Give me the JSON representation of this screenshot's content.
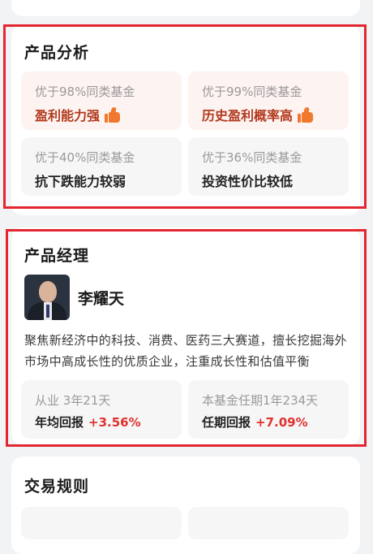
{
  "analysis": {
    "title": "产品分析",
    "tiles": [
      {
        "sub": "优于98%同类基金",
        "main": "盈利能力强",
        "thumb": true,
        "highlight": true
      },
      {
        "sub": "优于99%同类基金",
        "main": "历史盈利概率高",
        "thumb": true,
        "highlight": true
      },
      {
        "sub": "优于40%同类基金",
        "main": "抗下跌能力较弱",
        "thumb": false,
        "highlight": false
      },
      {
        "sub": "优于36%同类基金",
        "main": "投资性价比较低",
        "thumb": false,
        "highlight": false
      }
    ]
  },
  "manager": {
    "title": "产品经理",
    "name": "李耀天",
    "description": "聚焦新经济中的科技、消费、医药三大赛道，擅长挖掘海外市场中高成长性的优质企业，注重成长性和估值平衡",
    "stats": [
      {
        "sub": "从业 3年21天",
        "label": "年均回报",
        "value": "+3.56%"
      },
      {
        "sub": "本基金任期1年234天",
        "label": "任期回报",
        "value": "+7.09%"
      }
    ]
  },
  "rules": {
    "title": "交易规则"
  },
  "colors": {
    "accent_red": "#e0322e",
    "highlight_text": "#b23a1d",
    "thumb_orange": "#f0792e",
    "annotation_red": "#e3262f"
  }
}
